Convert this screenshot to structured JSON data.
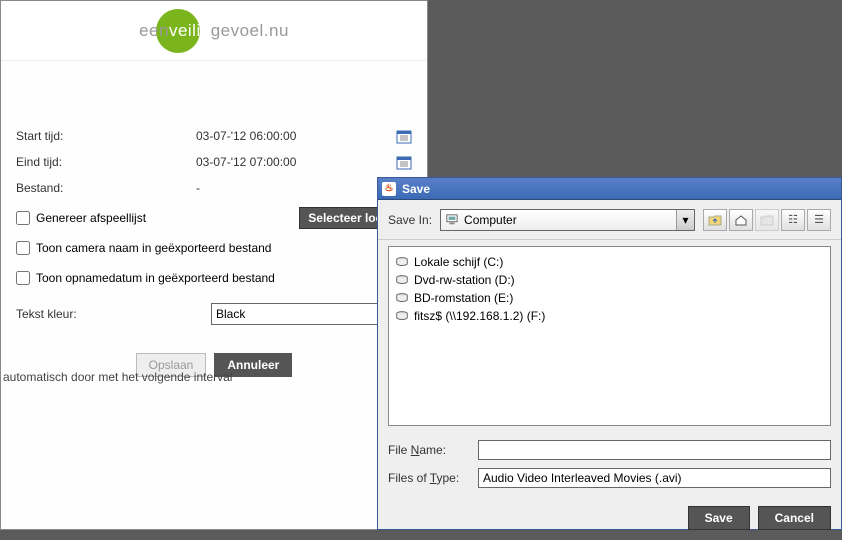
{
  "logo": {
    "text_pre": "een",
    "text_accent": "veilig",
    "text_post": "gevoel.nu"
  },
  "form": {
    "start_label": "Start tijd:",
    "start_value": "03-07-'12  06:00:00",
    "end_label": "Eind tijd:",
    "end_value": "03-07-'12  07:00:00",
    "file_label": "Bestand:",
    "file_value": "-",
    "gen_playlist_label": "Genereer afspeellijst",
    "select_location_label": "Selecteer locatie",
    "show_camera_label": "Toon camera naam in geëxporteerd bestand",
    "show_date_label": "Toon opnamedatum in geëxporteerd bestand",
    "text_color_label": "Tekst kleur:",
    "text_color_value": "Black",
    "save_btn": "Opslaan",
    "cancel_btn": "Annuleer"
  },
  "partial_text": "automatisch door met het volgende interval",
  "save_dialog": {
    "title": "Save",
    "save_in_label": "Save In:",
    "save_in_value": "Computer",
    "drives": [
      "Lokale schijf (C:)",
      "Dvd-rw-station (D:)",
      "BD-romstation (E:)",
      "fitsz$ (\\\\192.168.1.2) (F:)"
    ],
    "file_name_label_pre": "File ",
    "file_name_label_u": "N",
    "file_name_label_post": "ame:",
    "file_name_value": "",
    "file_type_label_pre": "Files of ",
    "file_type_label_u": "T",
    "file_type_label_post": "ype:",
    "file_type_value": "Audio Video Interleaved Movies (.avi)",
    "save_btn": "Save",
    "cancel_btn": "Cancel"
  }
}
